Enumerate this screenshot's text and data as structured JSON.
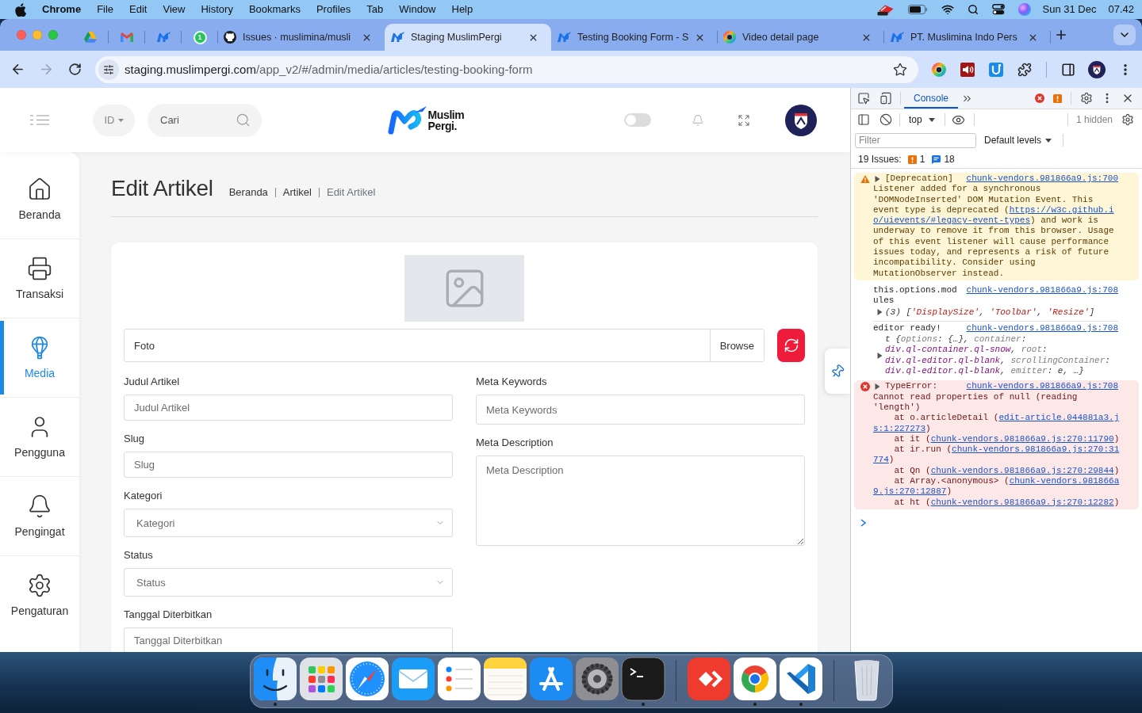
{
  "menu_bar": {
    "app": "Chrome",
    "menus": [
      "File",
      "Edit",
      "View",
      "History",
      "Bookmarks",
      "Profiles",
      "Tab",
      "Window",
      "Help"
    ],
    "date": "Sun 31 Dec",
    "time": "07.42"
  },
  "tabs": [
    {
      "kind": "pinned",
      "selected": false
    },
    {
      "kind": "pinned",
      "selected": false
    },
    {
      "kind": "pinned",
      "selected": false
    },
    {
      "kind": "pinned",
      "selected": false,
      "badge": "1"
    },
    {
      "kind": "normal",
      "title": "Issues · muslimina/musli",
      "selected": false
    },
    {
      "kind": "normal",
      "title": "Staging MuslimPergi",
      "selected": true
    },
    {
      "kind": "normal",
      "title": "Testing Booking Form - S",
      "selected": false
    },
    {
      "kind": "normal",
      "title": "Video detail page",
      "selected": false
    },
    {
      "kind": "normal",
      "title": "PT. Muslimina Indo Pers",
      "selected": false
    }
  ],
  "toolbar": {
    "back": {
      "disabled": false
    },
    "forward": {
      "disabled": true
    },
    "address": {
      "host": "staging.muslimpergi.com",
      "path": "/app_v2/#/admin/media/articles/testing-booking-form"
    }
  },
  "page": {
    "header": {
      "language": "ID",
      "search": {
        "placeholder": "Cari"
      },
      "logo_text": [
        "Muslim",
        "Pergi."
      ],
      "theme_switch": {
        "on": false
      }
    },
    "sidebar": {
      "items": [
        {
          "label": "Beranda",
          "selected": false
        },
        {
          "label": "Transaksi",
          "selected": false
        },
        {
          "label": "Media",
          "selected": true
        },
        {
          "label": "Pengguna",
          "selected": false
        },
        {
          "label": "Pengingat",
          "selected": false
        },
        {
          "label": "Pengaturan",
          "selected": false
        }
      ]
    },
    "title": "Edit Artikel",
    "breadcrumbs": [
      {
        "label": "Beranda",
        "current": false
      },
      {
        "label": "Artikel",
        "current": false
      },
      {
        "label": "Edit Artikel",
        "current": true
      }
    ],
    "form": {
      "photo": {
        "label": "Foto",
        "button": "Browse"
      },
      "left_fields": [
        {
          "kind": "text",
          "label": "Judul Artikel",
          "placeholder": "Judul Artikel"
        },
        {
          "kind": "text",
          "label": "Slug",
          "placeholder": "Slug"
        },
        {
          "kind": "select",
          "label": "Kategori",
          "placeholder": "Kategori"
        },
        {
          "kind": "select",
          "label": "Status",
          "placeholder": "Status"
        },
        {
          "kind": "text",
          "label": "Tanggal Diterbitkan",
          "placeholder": "Tanggal Diterbitkan"
        }
      ],
      "right_fields": [
        {
          "kind": "text",
          "label": "Meta Keywords",
          "placeholder": "Meta Keywords"
        },
        {
          "kind": "textarea",
          "label": "Meta Description",
          "placeholder": "Meta Description"
        }
      ]
    }
  },
  "devtools": {
    "tabs": [
      {
        "label": "Console",
        "selected": true
      }
    ],
    "context": "top",
    "hidden": "1 hidden",
    "filter": {
      "placeholder": "Filter"
    },
    "levels": "Default levels",
    "issues": {
      "label": "19 Issues:",
      "counts": [
        {
          "kind": "warning",
          "count": "1"
        },
        {
          "kind": "info",
          "count": "18"
        }
      ]
    },
    "messages": [
      {
        "kind": "warning",
        "expanded": false,
        "head": "[Deprecation]",
        "source": "chunk-vendors.981866a9.js:700",
        "body": [
          [
            {
              "kind": "text",
              "text": "Listener added for a synchronous"
            }
          ],
          [
            {
              "kind": "text",
              "text": "'DOMNodeInserted' DOM Mutation Event. This"
            }
          ],
          [
            {
              "kind": "text",
              "text": "event type is deprecated ("
            },
            {
              "kind": "link",
              "text": "https://w3c.github.i"
            }
          ],
          [
            {
              "kind": "link",
              "text": "o/uievents/#legacy-event-types"
            },
            {
              "kind": "text",
              "text": ") and work is"
            }
          ],
          [
            {
              "kind": "text",
              "text": "underway to remove it from this browser. Usage"
            }
          ],
          [
            {
              "kind": "text",
              "text": "of this event listener will cause performance"
            }
          ],
          [
            {
              "kind": "text",
              "text": "issues today, and represents a risk of future"
            }
          ],
          [
            {
              "kind": "text",
              "text": "incompatibility. Consider using"
            }
          ],
          [
            {
              "kind": "text",
              "text": "MutationObserver instead."
            }
          ]
        ]
      },
      {
        "kind": "log",
        "head": "this.options.mod\nules",
        "source": "chunk-vendors.981866a9.js:708",
        "detail": {
          "expanded": false,
          "parts": [
            {
              "kind": "punct",
              "text": "(3) ["
            },
            {
              "kind": "string",
              "text": "'DisplaySize'"
            },
            {
              "kind": "punct",
              "text": ", "
            },
            {
              "kind": "string",
              "text": "'Toolbar'"
            },
            {
              "kind": "punct",
              "text": ", "
            },
            {
              "kind": "string",
              "text": "'Resize'"
            },
            {
              "kind": "punct",
              "text": "]"
            }
          ]
        }
      },
      {
        "kind": "log",
        "head": "editor ready!",
        "source": "chunk-vendors.981866a9.js:708",
        "detail": {
          "expanded": false,
          "parts": [
            {
              "kind": "punct",
              "text": "t {"
            },
            {
              "kind": "key",
              "text": "options"
            },
            {
              "kind": "punct",
              "text": ": {…}, "
            },
            {
              "kind": "key",
              "text": "container"
            },
            {
              "kind": "punct",
              "text": ":\n"
            },
            {
              "kind": "node",
              "text": "div.ql-container.ql-snow"
            },
            {
              "kind": "punct",
              "text": ", "
            },
            {
              "kind": "key",
              "text": "root"
            },
            {
              "kind": "punct",
              "text": ":\n"
            },
            {
              "kind": "node",
              "text": "div.ql-editor.ql-blank"
            },
            {
              "kind": "punct",
              "text": ", "
            },
            {
              "kind": "key",
              "text": "scrollingContainer"
            },
            {
              "kind": "punct",
              "text": ":\n"
            },
            {
              "kind": "node",
              "text": "div.ql-editor.ql-blank"
            },
            {
              "kind": "punct",
              "text": ", "
            },
            {
              "kind": "key",
              "text": "emitter"
            },
            {
              "kind": "punct",
              "text": ": e, …}"
            }
          ]
        }
      },
      {
        "kind": "error",
        "expanded": false,
        "head": "TypeError:",
        "source": "chunk-vendors.981866a9.js:708",
        "body": [
          [
            {
              "kind": "text",
              "text": "Cannot read properties of null (reading"
            }
          ],
          [
            {
              "kind": "text",
              "text": "'length')"
            }
          ],
          [
            {
              "kind": "text",
              "text": "    at o.articleDetail ("
            },
            {
              "kind": "link",
              "text": "edit-article.044881a3.j"
            }
          ],
          [
            {
              "kind": "link",
              "text": "s:1:227273"
            },
            {
              "kind": "text",
              "text": ")"
            }
          ],
          [
            {
              "kind": "text",
              "text": "    at it ("
            },
            {
              "kind": "link",
              "text": "chunk-vendors.981866a9.js:270:11790"
            },
            {
              "kind": "text",
              "text": ")"
            }
          ],
          [
            {
              "kind": "text",
              "text": "    at ir.run ("
            },
            {
              "kind": "link",
              "text": "chunk-vendors.981866a9.js:270:31"
            }
          ],
          [
            {
              "kind": "link",
              "text": "774"
            },
            {
              "kind": "text",
              "text": ")"
            }
          ],
          [
            {
              "kind": "text",
              "text": "    at Qn ("
            },
            {
              "kind": "link",
              "text": "chunk-vendors.981866a9.js:270:29844"
            },
            {
              "kind": "text",
              "text": ")"
            }
          ],
          [
            {
              "kind": "text",
              "text": "    at Array.<anonymous> ("
            },
            {
              "kind": "link",
              "text": "chunk-vendors.981866a"
            }
          ],
          [
            {
              "kind": "link",
              "text": "9.js:270:12887"
            },
            {
              "kind": "text",
              "text": ")"
            }
          ],
          [
            {
              "kind": "text",
              "text": "    at ht ("
            },
            {
              "kind": "link",
              "text": "chunk-vendors.981866a9.js:270:12282"
            },
            {
              "kind": "text",
              "text": ")"
            }
          ]
        ]
      }
    ]
  },
  "dock": {
    "groups": [
      [
        {
          "running": true
        },
        {
          "running": false
        },
        {
          "running": false
        },
        {
          "running": false
        },
        {
          "running": false
        },
        {
          "running": false
        },
        {
          "running": false
        },
        {
          "running": false
        },
        {
          "running": true
        }
      ],
      [
        {
          "running": false
        },
        {
          "running": true
        },
        {
          "running": true
        }
      ],
      [
        {
          "running": false
        }
      ]
    ]
  }
}
